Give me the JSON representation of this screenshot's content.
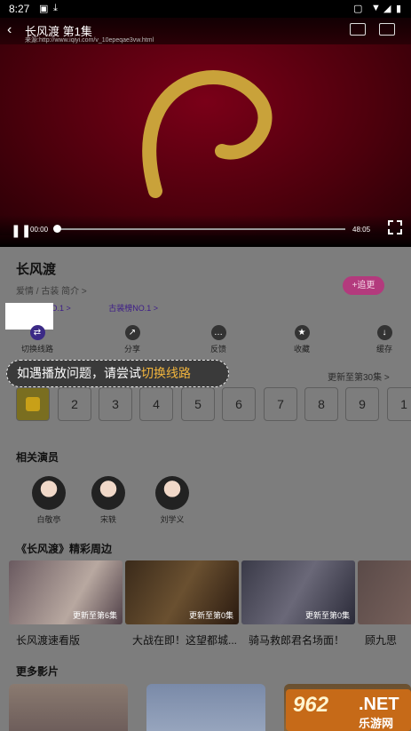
{
  "status_bar": {
    "time": "8:27"
  },
  "player": {
    "title": "长风渡 第1集",
    "source": "来源:http://www.iqiyi.com/v_10epeqae3vw.html",
    "time_current": "00:00",
    "time_total": "48:05",
    "progress": 0.0
  },
  "drama": {
    "title": "长风渡",
    "tags": "爱情 / 古装   简介 >",
    "follow_label": "+追更",
    "rank_1": "爱情榜NO.1 >",
    "rank_2": "古装榜NO.1 >"
  },
  "actions": [
    {
      "label": "切换线路",
      "icon": "switch-line"
    },
    {
      "label": "分享",
      "icon": "share"
    },
    {
      "label": "反馈",
      "icon": "feedback"
    },
    {
      "label": "收藏",
      "icon": "collect"
    },
    {
      "label": "缓存",
      "icon": "download"
    }
  ],
  "toast": {
    "text": "如遇播放问题，请尝试",
    "highlight": "切换线路"
  },
  "episodes": {
    "update_text": "更新至第30集 >",
    "items": [
      "",
      "2",
      "3",
      "4",
      "5",
      "6",
      "7",
      "8",
      "9",
      "1"
    ]
  },
  "actors_section": {
    "title": "相关演员",
    "actors": [
      "白敬亭",
      "宋轶",
      "刘学义"
    ]
  },
  "highlights_section": {
    "title": "《长风渡》精彩周边",
    "cards": [
      {
        "title": "长风渡速看版",
        "tag": "更新至第6集"
      },
      {
        "title": "大战在即！这望都城...",
        "tag": "更新至第0集"
      },
      {
        "title": "骑马救郎君名场面！",
        "tag": "更新至第0集"
      },
      {
        "title": "顾九思",
        "tag": ""
      }
    ]
  },
  "more_section": {
    "title": "更多影片"
  },
  "watermark": {
    "number": "962",
    "domain": ".NET",
    "site": "乐游网"
  }
}
